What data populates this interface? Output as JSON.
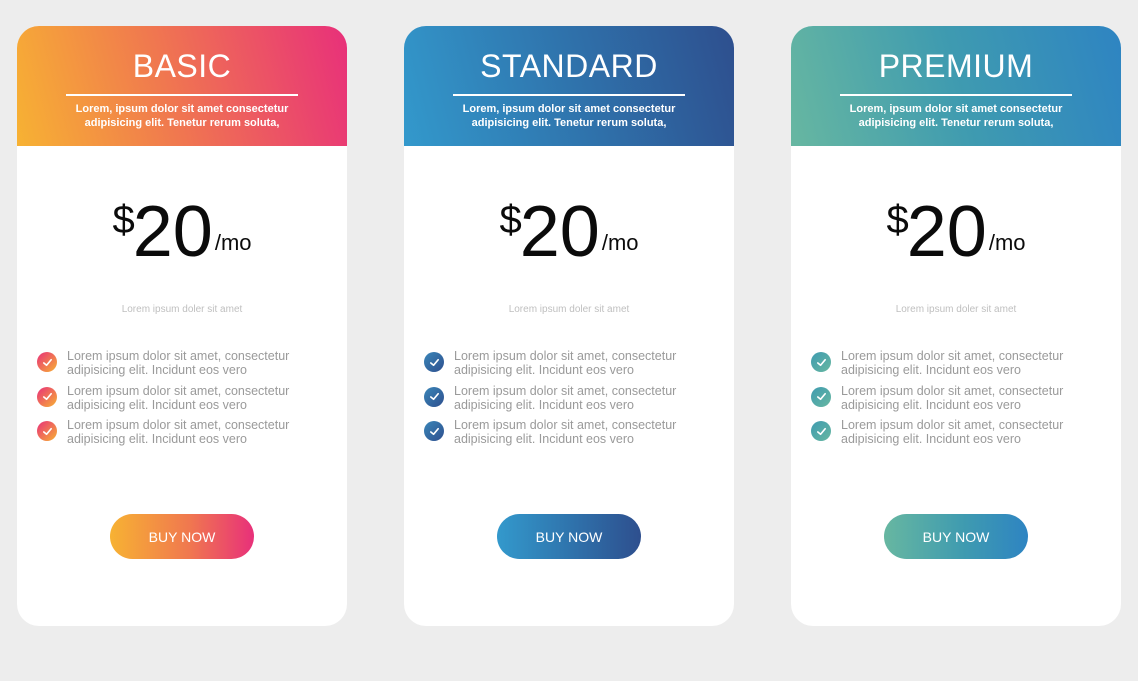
{
  "plans": [
    {
      "name": "BASIC",
      "description": "Lorem, ipsum dolor sit amet consectetur adipisicing elit. Tenetur rerum soluta,",
      "currency": "$",
      "amount": "20",
      "period": "/mo",
      "subtitle": "Lorem ipsum doler sit amet",
      "features": [
        "Lorem ipsum dolor sit amet, consectetur adipisicing elit. Incidunt eos vero",
        "Lorem ipsum dolor sit amet, consectetur adipisicing elit. Incidunt eos vero",
        "Lorem ipsum dolor sit amet, consectetur adipisicing elit. Incidunt eos vero"
      ],
      "button_label": "BUY NOW",
      "colors": {
        "start": "#f7b233",
        "end": "#e8307a"
      }
    },
    {
      "name": "STANDARD",
      "description": "Lorem, ipsum dolor sit amet consectetur adipisicing elit. Tenetur rerum soluta,",
      "currency": "$",
      "amount": "20",
      "period": "/mo",
      "subtitle": "Lorem ipsum doler sit amet",
      "features": [
        "Lorem ipsum dolor sit amet, consectetur adipisicing elit. Incidunt eos vero",
        "Lorem ipsum dolor sit amet, consectetur adipisicing elit. Incidunt eos vero",
        "Lorem ipsum dolor sit amet, consectetur adipisicing elit. Incidunt eos vero"
      ],
      "button_label": "BUY NOW",
      "colors": {
        "start": "#3399cc",
        "end": "#2e4f8e"
      }
    },
    {
      "name": "PREMIUM",
      "description": "Lorem, ipsum dolor sit amet consectetur adipisicing elit. Tenetur rerum soluta,",
      "currency": "$",
      "amount": "20",
      "period": "/mo",
      "subtitle": "Lorem ipsum doler sit amet",
      "features": [
        "Lorem ipsum dolor sit amet, consectetur adipisicing elit. Incidunt eos vero",
        "Lorem ipsum dolor sit amet, consectetur adipisicing elit. Incidunt eos vero",
        "Lorem ipsum dolor sit amet, consectetur adipisicing elit. Incidunt eos vero"
      ],
      "button_label": "BUY NOW",
      "colors": {
        "start": "#67b7a1",
        "end": "#2e84c2"
      }
    }
  ],
  "icons": {
    "feature_bullet": "check-icon"
  },
  "page": {
    "background": "#ededed"
  }
}
